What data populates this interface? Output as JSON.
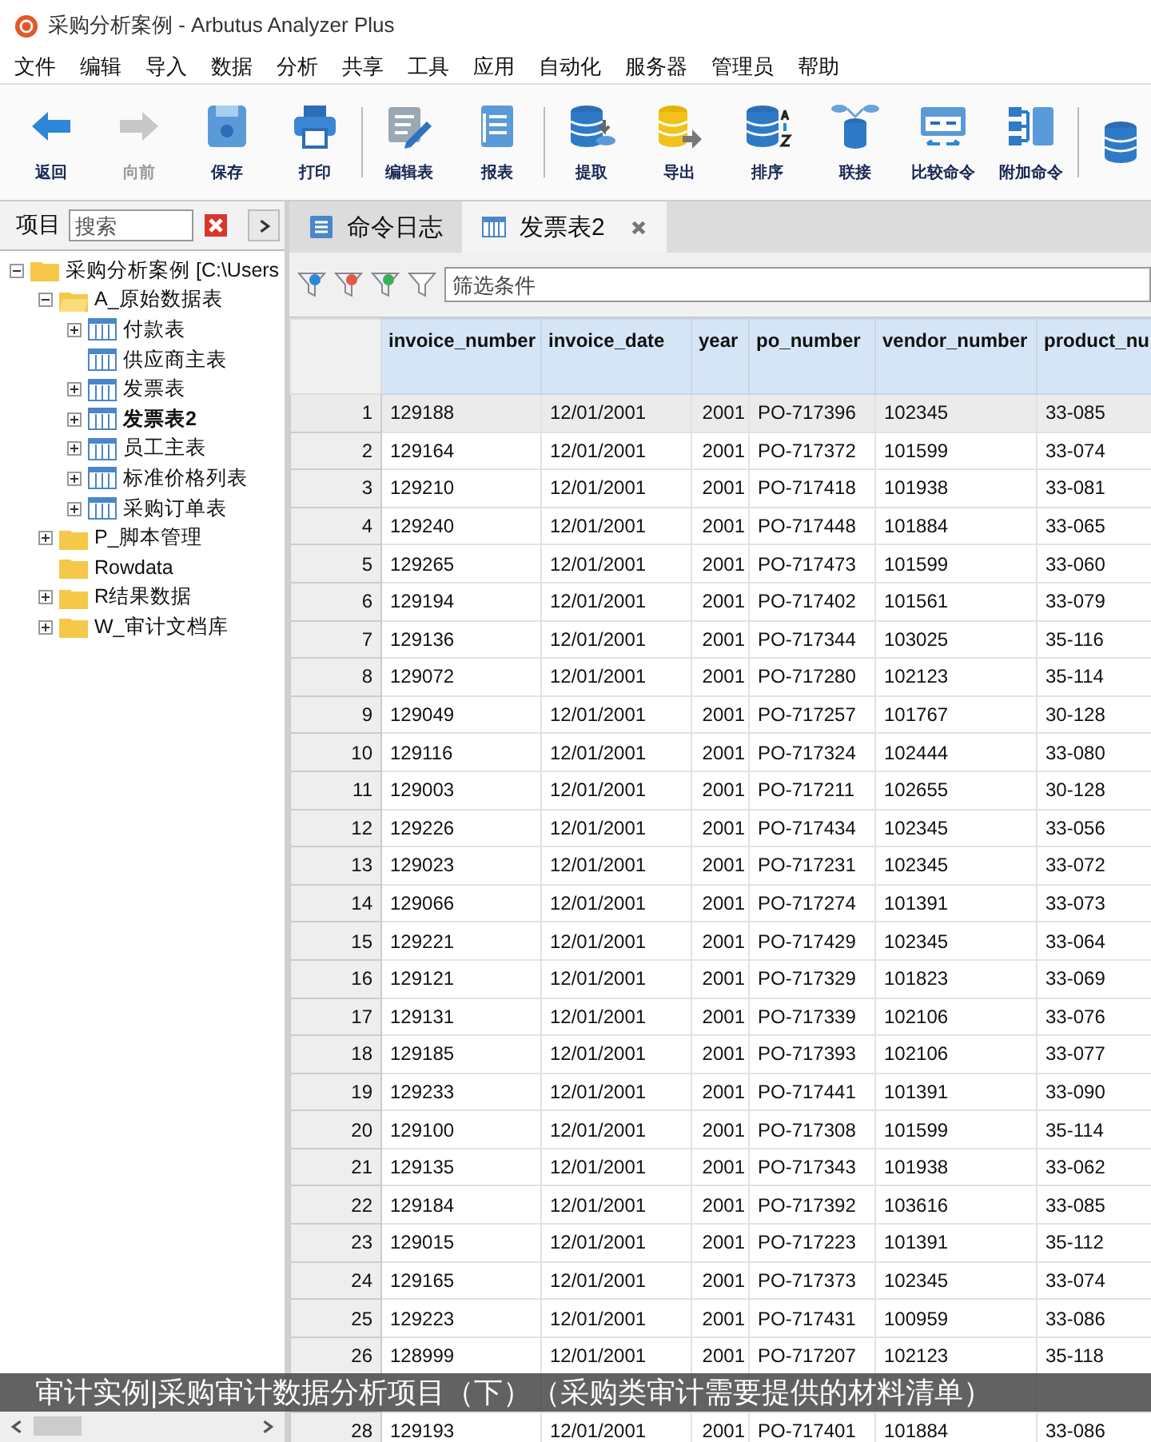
{
  "window": {
    "title": "采购分析案例 - Arbutus Analyzer Plus"
  },
  "menu": [
    "文件",
    "编辑",
    "导入",
    "数据",
    "分析",
    "共享",
    "工具",
    "应用",
    "自动化",
    "服务器",
    "管理员",
    "帮助"
  ],
  "toolbar": [
    {
      "kind": "back",
      "label": "返回",
      "disabled": false
    },
    {
      "kind": "forward",
      "label": "向前",
      "disabled": true
    },
    {
      "kind": "save",
      "label": "保存",
      "disabled": false
    },
    {
      "kind": "print",
      "label": "打印",
      "disabled": false
    },
    {
      "kind": "edit",
      "label": "编辑表",
      "disabled": false
    },
    {
      "kind": "report",
      "label": "报表",
      "disabled": false
    },
    {
      "kind": "extract",
      "label": "提取",
      "disabled": false
    },
    {
      "kind": "export",
      "label": "导出",
      "disabled": false
    },
    {
      "kind": "sort",
      "label": "排序",
      "disabled": false
    },
    {
      "kind": "join",
      "label": "联接",
      "disabled": false
    },
    {
      "kind": "compare",
      "label": "比较命令",
      "disabled": false
    },
    {
      "kind": "append",
      "label": "附加命令",
      "disabled": false
    },
    {
      "kind": "db"
    }
  ],
  "sidebar": {
    "title": "项目",
    "search": {
      "placeholder": "搜索"
    },
    "tree": [
      {
        "label": "采购分析案例 [C:\\Users",
        "kind": "folder",
        "expanded": true,
        "selected": false,
        "children": [
          {
            "label": "A_原始数据表",
            "kind": "folder",
            "expanded": true,
            "selected": false,
            "children": [
              {
                "label": "付款表",
                "kind": "table",
                "expanded": false,
                "selected": false
              },
              {
                "label": "供应商主表",
                "kind": "table",
                "selected": false
              },
              {
                "label": "发票表",
                "kind": "table",
                "expanded": false,
                "selected": false
              },
              {
                "label": "发票表2",
                "kind": "table",
                "expanded": false,
                "selected": true
              },
              {
                "label": "员工主表",
                "kind": "table",
                "expanded": false,
                "selected": false
              },
              {
                "label": "标准价格列表",
                "kind": "table",
                "expanded": false,
                "selected": false
              },
              {
                "label": "采购订单表",
                "kind": "table",
                "expanded": false,
                "selected": false
              }
            ]
          },
          {
            "label": "P_脚本管理",
            "kind": "folder",
            "expanded": false,
            "selected": false
          },
          {
            "label": "Rowdata",
            "kind": "folder",
            "selected": false
          },
          {
            "label": "R结果数据",
            "kind": "folder",
            "expanded": false,
            "selected": false
          },
          {
            "label": "W_审计文档库",
            "kind": "folder",
            "expanded": false,
            "selected": false
          }
        ]
      }
    ]
  },
  "tabs": [
    {
      "label": "命令日志",
      "kind": "log",
      "selected": false,
      "closable": false
    },
    {
      "label": "发票表2",
      "kind": "table",
      "selected": true,
      "closable": true
    }
  ],
  "filter": {
    "placeholder": "筛选条件"
  },
  "table": {
    "columns": [
      "invoice_number",
      "invoice_date",
      "year",
      "po_number",
      "vendor_number",
      "product_nu"
    ],
    "rows": [
      {
        "number": "1",
        "selected": true,
        "cells": [
          "129188",
          "12/01/2001",
          "2001",
          "PO-717396",
          "102345",
          "33-085"
        ]
      },
      {
        "number": "2",
        "selected": false,
        "cells": [
          "129164",
          "12/01/2001",
          "2001",
          "PO-717372",
          "101599",
          "33-074"
        ]
      },
      {
        "number": "3",
        "selected": false,
        "cells": [
          "129210",
          "12/01/2001",
          "2001",
          "PO-717418",
          "101938",
          "33-081"
        ]
      },
      {
        "number": "4",
        "selected": false,
        "cells": [
          "129240",
          "12/01/2001",
          "2001",
          "PO-717448",
          "101884",
          "33-065"
        ]
      },
      {
        "number": "5",
        "selected": false,
        "cells": [
          "129265",
          "12/01/2001",
          "2001",
          "PO-717473",
          "101599",
          "33-060"
        ]
      },
      {
        "number": "6",
        "selected": false,
        "cells": [
          "129194",
          "12/01/2001",
          "2001",
          "PO-717402",
          "101561",
          "33-079"
        ]
      },
      {
        "number": "7",
        "selected": false,
        "cells": [
          "129136",
          "12/01/2001",
          "2001",
          "PO-717344",
          "103025",
          "35-116"
        ]
      },
      {
        "number": "8",
        "selected": false,
        "cells": [
          "129072",
          "12/01/2001",
          "2001",
          "PO-717280",
          "102123",
          "35-114"
        ]
      },
      {
        "number": "9",
        "selected": false,
        "cells": [
          "129049",
          "12/01/2001",
          "2001",
          "PO-717257",
          "101767",
          "30-128"
        ]
      },
      {
        "number": "10",
        "selected": false,
        "cells": [
          "129116",
          "12/01/2001",
          "2001",
          "PO-717324",
          "102444",
          "33-080"
        ]
      },
      {
        "number": "11",
        "selected": false,
        "cells": [
          "129003",
          "12/01/2001",
          "2001",
          "PO-717211",
          "102655",
          "30-128"
        ]
      },
      {
        "number": "12",
        "selected": false,
        "cells": [
          "129226",
          "12/01/2001",
          "2001",
          "PO-717434",
          "102345",
          "33-056"
        ]
      },
      {
        "number": "13",
        "selected": false,
        "cells": [
          "129023",
          "12/01/2001",
          "2001",
          "PO-717231",
          "102345",
          "33-072"
        ]
      },
      {
        "number": "14",
        "selected": false,
        "cells": [
          "129066",
          "12/01/2001",
          "2001",
          "PO-717274",
          "101391",
          "33-073"
        ]
      },
      {
        "number": "15",
        "selected": false,
        "cells": [
          "129221",
          "12/01/2001",
          "2001",
          "PO-717429",
          "102345",
          "33-064"
        ]
      },
      {
        "number": "16",
        "selected": false,
        "cells": [
          "129121",
          "12/01/2001",
          "2001",
          "PO-717329",
          "101823",
          "33-069"
        ]
      },
      {
        "number": "17",
        "selected": false,
        "cells": [
          "129131",
          "12/01/2001",
          "2001",
          "PO-717339",
          "102106",
          "33-076"
        ]
      },
      {
        "number": "18",
        "selected": false,
        "cells": [
          "129185",
          "12/01/2001",
          "2001",
          "PO-717393",
          "102106",
          "33-077"
        ]
      },
      {
        "number": "19",
        "selected": false,
        "cells": [
          "129233",
          "12/01/2001",
          "2001",
          "PO-717441",
          "101391",
          "33-090"
        ]
      },
      {
        "number": "20",
        "selected": false,
        "cells": [
          "129100",
          "12/01/2001",
          "2001",
          "PO-717308",
          "101599",
          "35-114"
        ]
      },
      {
        "number": "21",
        "selected": false,
        "cells": [
          "129135",
          "12/01/2001",
          "2001",
          "PO-717343",
          "101938",
          "33-062"
        ]
      },
      {
        "number": "22",
        "selected": false,
        "cells": [
          "129184",
          "12/01/2001",
          "2001",
          "PO-717392",
          "103616",
          "33-085"
        ]
      },
      {
        "number": "23",
        "selected": false,
        "cells": [
          "129015",
          "12/01/2001",
          "2001",
          "PO-717223",
          "101391",
          "35-112"
        ]
      },
      {
        "number": "24",
        "selected": false,
        "cells": [
          "129165",
          "12/01/2001",
          "2001",
          "PO-717373",
          "102345",
          "33-074"
        ]
      },
      {
        "number": "25",
        "selected": false,
        "cells": [
          "129223",
          "12/01/2001",
          "2001",
          "PO-717431",
          "100959",
          "33-086"
        ]
      },
      {
        "number": "26",
        "selected": false,
        "cells": [
          "128999",
          "12/01/2001",
          "2001",
          "PO-717207",
          "102123",
          "35-118"
        ]
      },
      {
        "cells": []
      },
      {
        "number": "28",
        "selected": false,
        "cells": [
          "129193",
          "12/01/2001",
          "2001",
          "PO-717401",
          "101884",
          "33-086"
        ]
      }
    ]
  },
  "caption": "审计实例|采购审计数据分析项目（下）（采购类审计需要提供的材料清单）"
}
